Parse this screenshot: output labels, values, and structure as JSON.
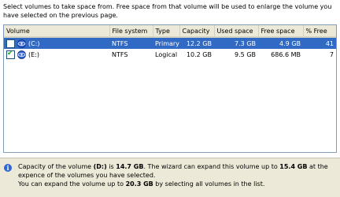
{
  "instructions": "Select volumes to take space from. Free space from that volume will be used to enlarge the volume you have selected on the previous page.",
  "table": {
    "columns": [
      "Volume",
      "File system",
      "Type",
      "Capacity",
      "Used space",
      "Free space",
      "% Free"
    ],
    "rows": [
      {
        "checked": false,
        "selected": true,
        "volume": "(C:)",
        "fs": "NTFS",
        "type": "Primary",
        "capacity": "12.2 GB",
        "used": "7.3 GB",
        "free": "4.9 GB",
        "pct": "41"
      },
      {
        "checked": true,
        "selected": false,
        "volume": "(E:)",
        "fs": "NTFS",
        "type": "Logical",
        "capacity": "10.2 GB",
        "used": "9.5 GB",
        "free": "686.6 MB",
        "pct": "7"
      }
    ]
  },
  "info": {
    "line1_a": "Capacity of the volume ",
    "line1_vol": "(D:)",
    "line1_b": " is ",
    "line1_cap": "14.7 GB",
    "line1_c": ". The wizard can expand this volume up to ",
    "line1_max": "15.4 GB",
    "line1_d": " at the expence of the volumes you have selected.",
    "line2_a": "You can expand the volume up to ",
    "line2_max": "20.3 GB",
    "line2_b": " by selecting all volumes in the list."
  },
  "icons": {
    "info": "info-icon",
    "disk": "disk-icon"
  },
  "colors": {
    "selection": "#316ac5",
    "header": "#ece9d8",
    "panel": "#ece9d8",
    "info_icon": "#2f66d4"
  }
}
